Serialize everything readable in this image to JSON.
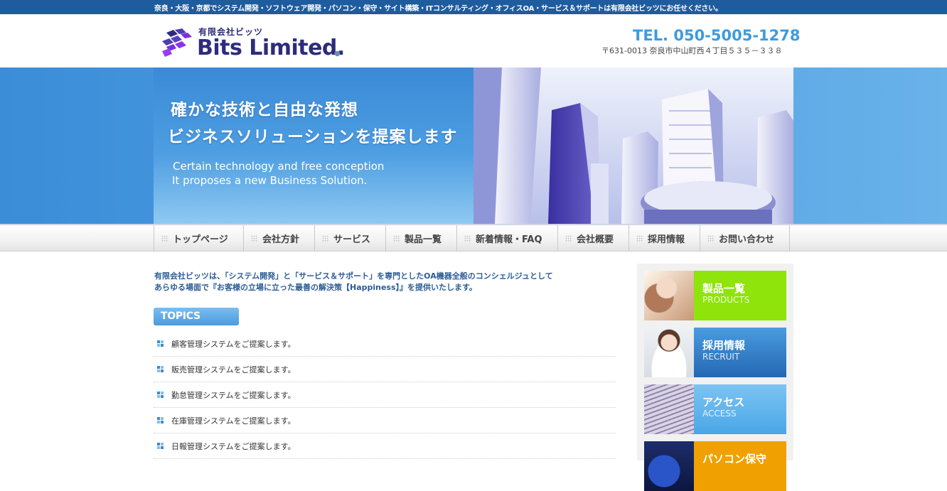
{
  "topbar": {
    "text": "奈良・大阪・京都でシステム開発・ソフトウェア開発・パソコン・保守・サイト構築・ITコンサルティング・オフィスOA・サービス＆サポートは有限会社ビッツにお任せください。"
  },
  "header": {
    "logo_sub": "有限会社ビッツ",
    "logo_main": "Bits Limited.",
    "tel": "TEL. 050-5005-1278",
    "address": "〒631-0013 奈良市中山町西４丁目５３５－３３８"
  },
  "hero": {
    "jp_line1": "確かな技術と自由な発想",
    "jp_line2": "ビジネスソリューションを提案します",
    "en_line1": "Certain technology and free conception",
    "en_line2": "It proposes a new Business Solution."
  },
  "nav": {
    "items": [
      {
        "label": "トップページ"
      },
      {
        "label": "会社方針"
      },
      {
        "label": "サービス"
      },
      {
        "label": "製品一覧"
      },
      {
        "label": "新着情報・FAQ"
      },
      {
        "label": "会社概要"
      },
      {
        "label": "採用情報"
      },
      {
        "label": "お問い合わせ"
      }
    ]
  },
  "intro": {
    "line1": "有限会社ビッツは、「システム開発」と「サービス＆サポート」を専門としたOA機器全般のコンシェルジュとして",
    "line2": "あらゆる場面で『お客様の立場に立った最善の解決策【Happiness】』を提供いたします。"
  },
  "topics": {
    "heading": "TOPICS",
    "items": [
      {
        "text": "顧客管理システムをご提案します。"
      },
      {
        "text": "販売管理システムをご提案します。"
      },
      {
        "text": "勤怠管理システムをご提案します。"
      },
      {
        "text": "在庫管理システムをご提案します。"
      },
      {
        "text": "日報管理システムをご提案します。"
      }
    ]
  },
  "sidebar": {
    "cards": [
      {
        "jp": "製品一覧",
        "en": "PRODUCTS",
        "color": "#8ee40b"
      },
      {
        "jp": "採用情報",
        "en": "RECRUIT",
        "color": "#2f7fcc"
      },
      {
        "jp": "アクセス",
        "en": "ACCESS",
        "color": "#5eb3ec"
      },
      {
        "jp": "パソコン保守",
        "en": "",
        "color": "#f0a000"
      }
    ]
  },
  "colors": {
    "topbar": "#1f5c9e",
    "brand_navy": "#2d2c7c",
    "brand_purple": "#7b2ee0",
    "tel_blue": "#3d9be0",
    "hero_blue": "#3b8dd8",
    "intro_text": "#2c5c95"
  }
}
